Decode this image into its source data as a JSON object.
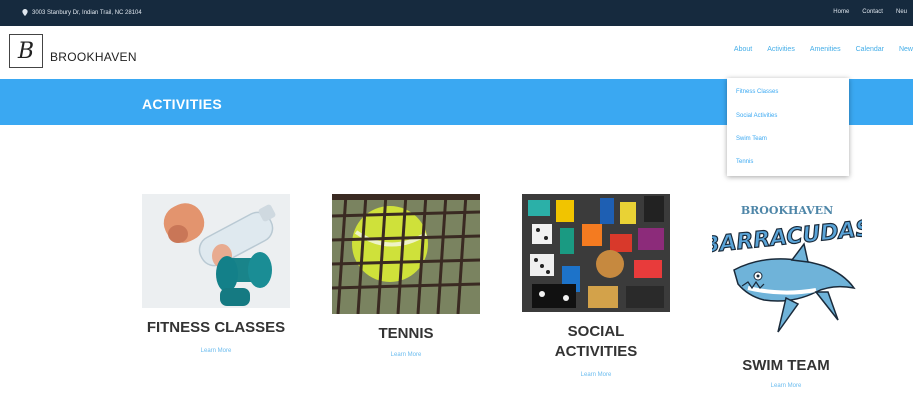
{
  "topbar": {
    "address": "3003 Stanbury Dr, Indian Trail, NC 28104",
    "links": [
      "Home",
      "Contact",
      "Neu"
    ]
  },
  "header": {
    "logo_letter": "B",
    "brand": "BROOKHAVEN",
    "nav": [
      "About",
      "Activities",
      "Amenities",
      "Calendar",
      "New"
    ]
  },
  "banner": {
    "title": "ACTIVITIES"
  },
  "dropdown": {
    "items": [
      "Fitness Classes",
      "Social Activities",
      "Swim Team",
      "Tennis"
    ]
  },
  "cards": [
    {
      "title": "FITNESS CLASSES",
      "link": "Learn More",
      "image": "fitness-photo"
    },
    {
      "title": "TENNIS",
      "link": "Learn More",
      "image": "tennis-photo"
    },
    {
      "title_line1": "SOCIAL",
      "title_line2": "ACTIVITIES",
      "link": "Learn More",
      "image": "social-games-photo"
    },
    {
      "title": "SWIM TEAM",
      "link": "Learn More",
      "image": "barracudas-logo",
      "logo_top": "BROOKHAVEN",
      "logo_main": "BARRACUDAS"
    }
  ],
  "colors": {
    "topbar": "#162a3e",
    "banner": "#3aa8f2",
    "nav_link": "#45aee8",
    "title_text": "#333333"
  }
}
